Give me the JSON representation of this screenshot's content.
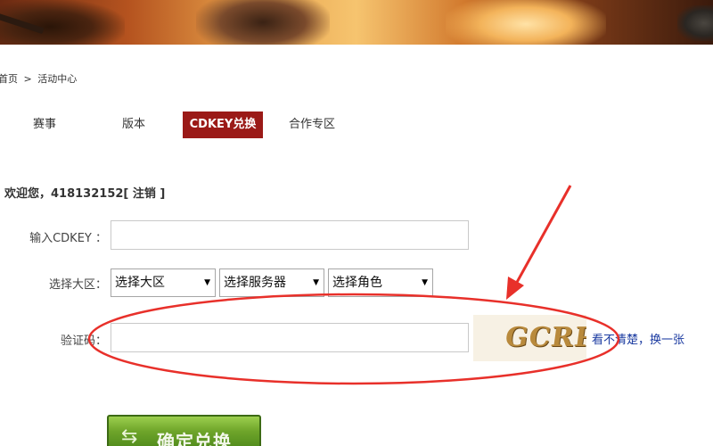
{
  "breadcrumb": {
    "home": "首页",
    "separator": ">",
    "current": "活动中心"
  },
  "tabs": [
    {
      "label": "赛事"
    },
    {
      "label": "版本"
    },
    {
      "label": "CDKEY兑换"
    },
    {
      "label": "合作专区"
    }
  ],
  "welcome": {
    "text": "欢迎您，418132152[ 注销 ]"
  },
  "form": {
    "cdkey_label": "输入CDKEY ：",
    "cdkey_value": "",
    "region_label": "选择大区：",
    "selects": [
      {
        "value": "选择大区"
      },
      {
        "value": "选择服务器"
      },
      {
        "value": "选择角色"
      }
    ],
    "captcha_label": "验证码：",
    "captcha_value": "",
    "captcha_text": "GCRP",
    "refresh_link": "看不清楚，换一张",
    "submit_label": "确定兑换"
  },
  "colors": {
    "active_tab": "#9b1a17",
    "annotation": "#e8302a",
    "link": "#1a3aa0",
    "submit": "#6fa52a"
  }
}
